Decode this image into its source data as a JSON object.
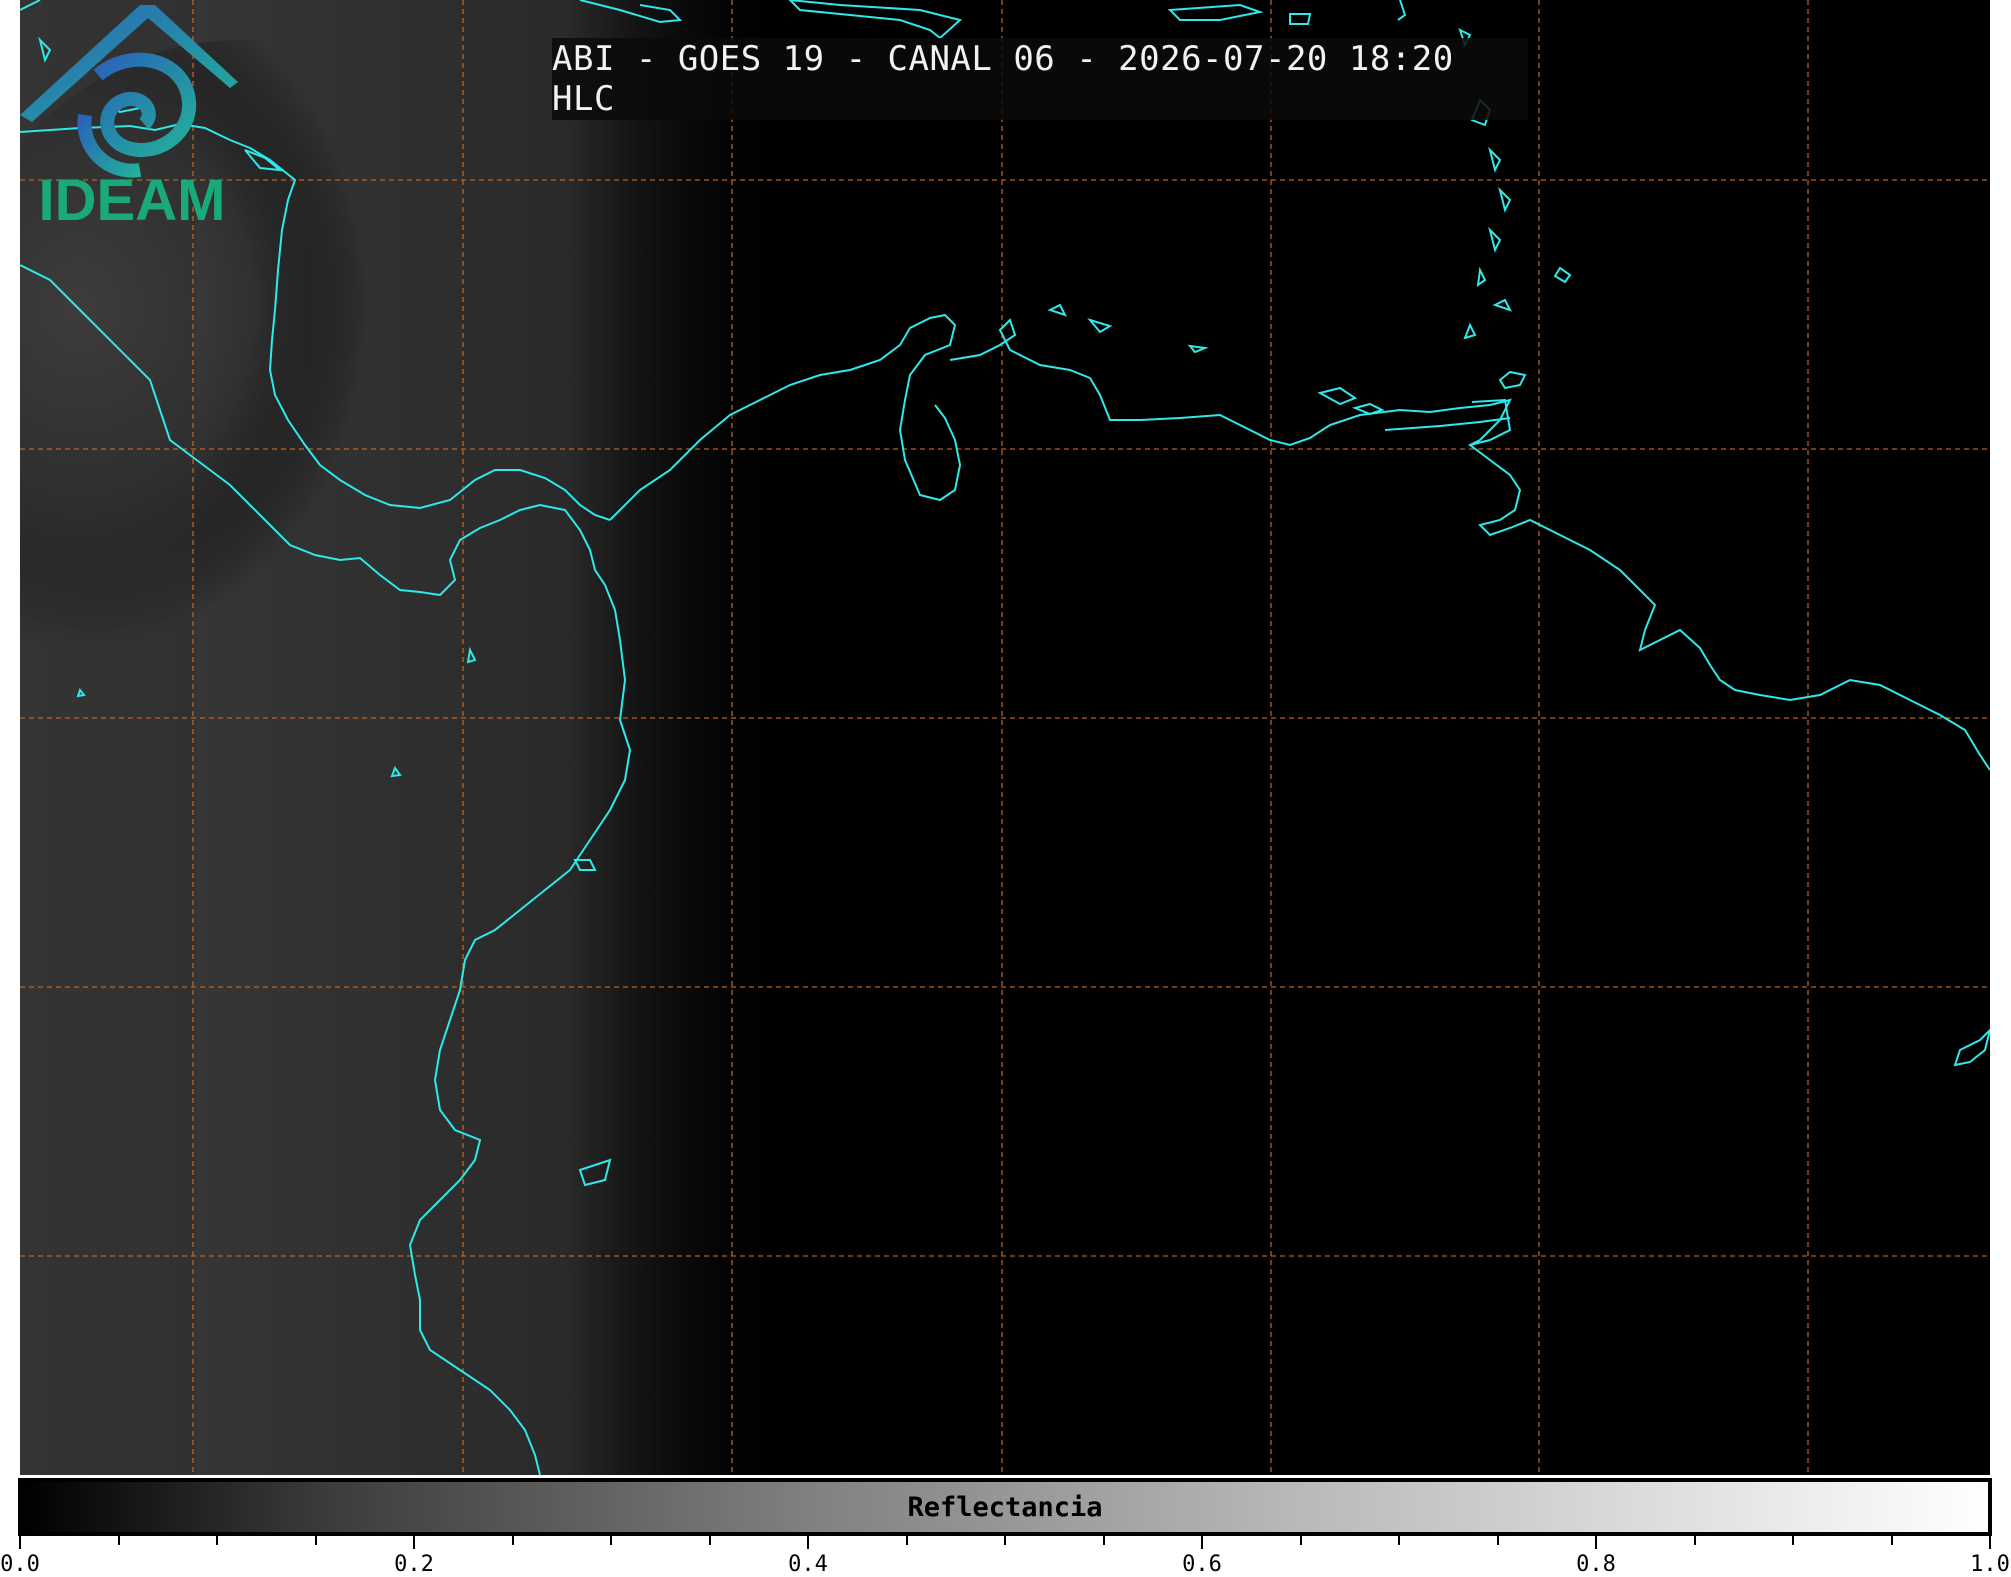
{
  "title": "ABI - GOES 19 - CANAL 06 - 2026-07-20 18:20 HLC",
  "colorbar": {
    "label": "Reflectancia",
    "ticks": [
      "0.0",
      "0.2",
      "0.4",
      "0.6",
      "0.8",
      "1.0"
    ],
    "range": [
      0.0,
      1.0
    ],
    "colormap": "grayscale black to white"
  },
  "logo": {
    "text": "IDEAM"
  },
  "colors": {
    "coastline": "#2fe8e8",
    "gridlines": "#d2691e",
    "background": "#000000",
    "logo_text": "#1aa97b"
  }
}
